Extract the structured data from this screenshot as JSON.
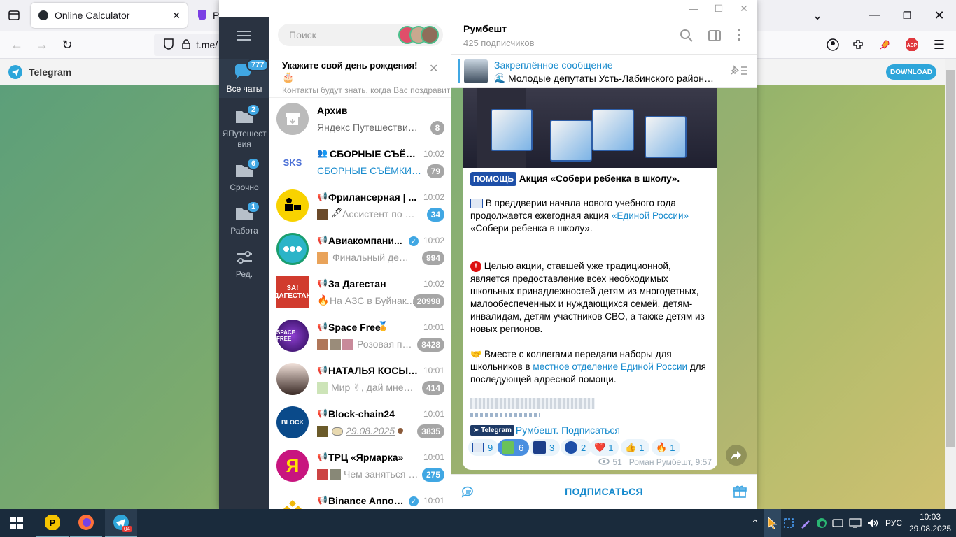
{
  "browser": {
    "tabs": [
      {
        "label": "Online Calculator"
      },
      {
        "label": "Pa"
      }
    ],
    "url": "t.me/",
    "banner_title": "Telegram",
    "banner_download": "DOWNLOAD",
    "abp_label": "ABP"
  },
  "telegram": {
    "folders": [
      {
        "label": "Все чаты",
        "badge": "777"
      },
      {
        "label": "ЯПутешествия",
        "badge": "2"
      },
      {
        "label": "Срочно",
        "badge": "6"
      },
      {
        "label": "Работа",
        "badge": "1"
      },
      {
        "label": "Ред.",
        "badge": ""
      }
    ],
    "search_placeholder": "Поиск",
    "birthday": {
      "title": "Укажите свой день рождения!",
      "subtitle": "Контакты будут знать, когда Вас поздравить"
    },
    "chats": [
      {
        "name": "Архив",
        "time": "",
        "msg": "Яндекс Путешествия, ...",
        "badge": "8",
        "badge_blue": false
      },
      {
        "name": "СБОРНЫЕ СЪЁМК...",
        "time": "10:02",
        "msg": "СБОРНЫЕ СЪЁМКИ | Ф...",
        "badge": "79",
        "badge_blue": false
      },
      {
        "name": "Фрилансерная | ...",
        "time": "10:02",
        "msg": "Ассистент по фо...",
        "badge": "34",
        "badge_blue": true
      },
      {
        "name": "Авиакомпани...",
        "time": "10:02",
        "msg": "Финальный день ...",
        "badge": "994",
        "badge_blue": false
      },
      {
        "name": "За Дагестан",
        "time": "10:02",
        "msg": "На АЗС в Буйнак...",
        "badge": "20998",
        "badge_blue": false
      },
      {
        "name": "Space Free",
        "time": "10:01",
        "msg": "Розовая по...",
        "badge": "8428",
        "badge_blue": false
      },
      {
        "name": "НАТАЛЬЯ КОСЫРЕ...",
        "time": "10:01",
        "msg": "Мир ✌, дай мне г...",
        "badge": "414",
        "badge_blue": false
      },
      {
        "name": "Block-chain24",
        "time": "10:01",
        "msg": "29.08.2025",
        "badge": "3835",
        "badge_blue": false
      },
      {
        "name": "ТРЦ «Ярмарка»",
        "time": "10:01",
        "msg": "Чем заняться в ...",
        "badge": "275",
        "badge_blue": true
      },
      {
        "name": "Binance Annou...",
        "time": "10:01",
        "msg": "",
        "badge": "",
        "badge_blue": false
      }
    ],
    "channel": {
      "name": "Румбешт",
      "subscribers": "425 подписчиков",
      "pinned_title": "Закреплённое сообщение",
      "pinned_text": "Молодые депутаты Усть-Лабинского района ...",
      "post": {
        "tag": "ПОМОЩЬ",
        "headline": "Акция «Собери ребенка в школу».",
        "p1_a": "В преддверии начала нового учебного года продолжается ежегодная акция ",
        "p1_link": "«Единой России»",
        "p1_b": " «Собери ребенка в школу».",
        "p2": "Целью акции, ставшей уже традиционной, является предоставление всех необходимых школьных принадлежностей детям из многодетных, малообеспеченных и нуждающихся семей, детям-инвалидам, детям участников СВО, а также детям из новых регионов.",
        "p3_a": "Вместе с коллегами передали наборы для школьников в ",
        "p3_link": "местное отделение Единой России",
        "p3_b": " для последующей адресной помощи.",
        "tg_badge": "Telegram",
        "subscribe_link": "Румбешт. Подписаться",
        "reactions": [
          {
            "emoji": "ER",
            "count": "9"
          },
          {
            "emoji": "pin",
            "count": "6"
          },
          {
            "emoji": "med",
            "count": "3"
          },
          {
            "emoji": "ER2",
            "count": "2"
          },
          {
            "emoji": "❤️",
            "count": "1"
          },
          {
            "emoji": "👍",
            "count": "1"
          },
          {
            "emoji": "🔥",
            "count": "1"
          }
        ],
        "views": "51",
        "author_time": "Роман Румбешт, 9:57"
      },
      "subscribe_button": "ПОДПИСАТЬСЯ"
    }
  },
  "taskbar": {
    "language": "РУС",
    "time": "10:03",
    "date": "29.08.2025",
    "telegram_badge": "04"
  },
  "colors": {
    "accent": "#40a7e3",
    "folder_bg": "#2a3341",
    "link": "#168acd",
    "taskbar": "#1a2b3c"
  }
}
